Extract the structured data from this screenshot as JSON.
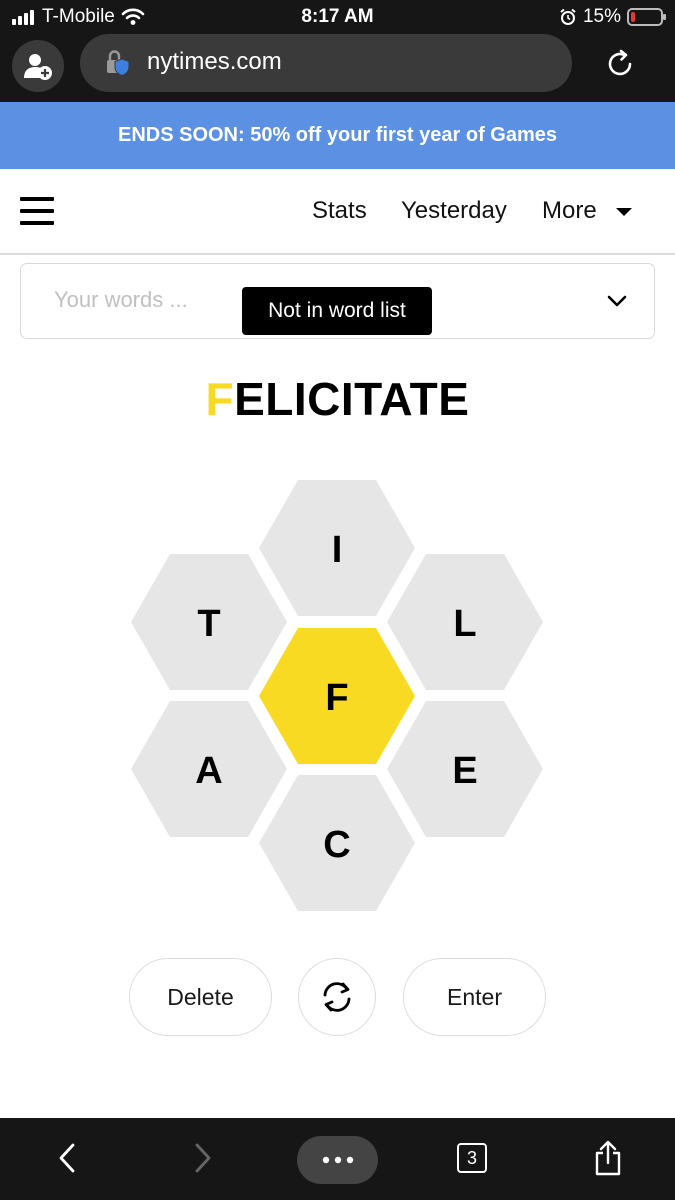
{
  "status_bar": {
    "carrier": "T-Mobile",
    "time": "8:17 AM",
    "battery_percent": "15%",
    "battery_level": 0.15,
    "icons": [
      "signal-icon",
      "wifi-icon",
      "alarm-icon",
      "battery-icon"
    ]
  },
  "browser": {
    "url": "nytimes.com",
    "tab_count": "3",
    "icons": [
      "profile-icon",
      "lock-shield-icon",
      "reload-icon",
      "back-icon",
      "forward-icon",
      "more-icon",
      "tabs-icon",
      "share-icon"
    ]
  },
  "banner": {
    "text": "ENDS SOON: 50% off your first year of Games",
    "color": "#5b90e2"
  },
  "nav": {
    "stats": "Stats",
    "yesterday": "Yesterday",
    "more": "More"
  },
  "words_box": {
    "placeholder": "Your words ...",
    "toast": "Not in word list"
  },
  "current_word": {
    "first_letter": "F",
    "rest": "ELICITATE"
  },
  "hive": {
    "center_color": "#f7da21",
    "outer_color": "#e6e6e6",
    "letters": {
      "top": "I",
      "upper_left": "T",
      "upper_right": "L",
      "center": "F",
      "lower_left": "A",
      "lower_right": "E",
      "bottom": "C"
    }
  },
  "controls": {
    "delete": "Delete",
    "enter": "Enter",
    "shuffle_icon": "shuffle-icon"
  }
}
